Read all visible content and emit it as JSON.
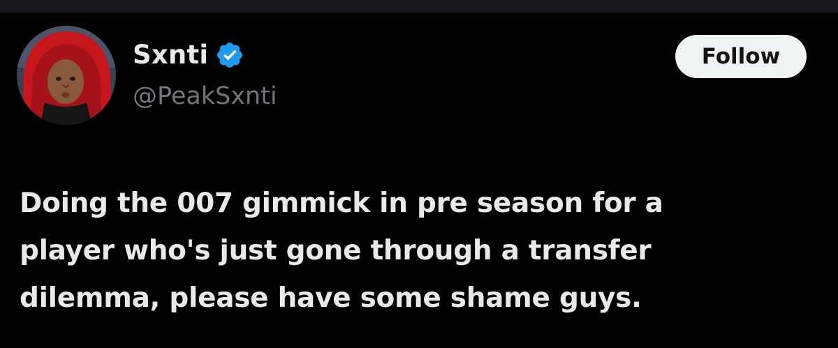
{
  "tweet": {
    "author": {
      "display_name": "Sxnti",
      "handle": "@PeakSxnti",
      "verified": true,
      "avatar_icon": "avatar-person-red-hood-icon"
    },
    "follow_label": "Follow",
    "text_lines": [
      "Doing the 007 gimmick in pre season for a",
      "player who's just gone through a transfer",
      "dilemma, please have some shame guys."
    ]
  },
  "colors": {
    "background": "#000000",
    "text_primary": "#e7e9ea",
    "text_secondary": "#71767b",
    "verified_badge": "#1d9bf0",
    "follow_button_bg": "#eff3f4",
    "follow_button_text": "#0f1419"
  }
}
